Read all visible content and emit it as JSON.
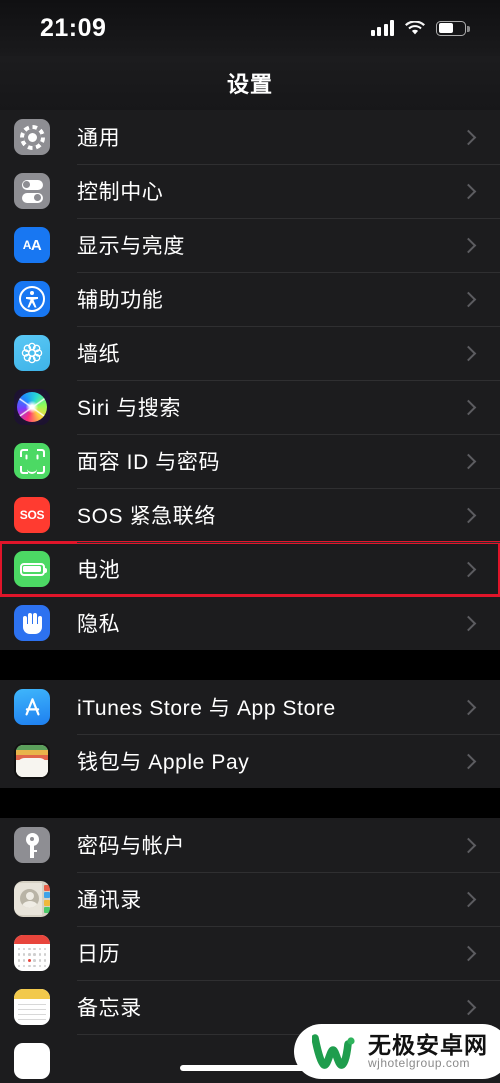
{
  "status_bar": {
    "time": "21:09",
    "signal_icon": "cellular-bars-icon",
    "wifi_icon": "wifi-icon",
    "battery_icon": "battery-icon"
  },
  "nav": {
    "title": "设置"
  },
  "colors": {
    "page_background": "#000000",
    "row_background": "#1c1c1e",
    "separator": "#2f2f31",
    "label_text": "#ffffff",
    "chevron": "#5c5c60",
    "highlight_box": "#e0152a"
  },
  "groups": [
    {
      "rows": [
        {
          "label": "通用",
          "icon": "gear-icon",
          "chevron": true,
          "highlighted": false
        },
        {
          "label": "控制中心",
          "icon": "control-center-icon",
          "chevron": true,
          "highlighted": false
        },
        {
          "label": "显示与亮度",
          "icon": "display-brightness-icon",
          "chevron": true,
          "highlighted": false
        },
        {
          "label": "辅助功能",
          "icon": "accessibility-icon",
          "chevron": true,
          "highlighted": false
        },
        {
          "label": "墙纸",
          "icon": "wallpaper-icon",
          "chevron": true,
          "highlighted": false
        },
        {
          "label": "Siri 与搜索",
          "icon": "siri-icon",
          "chevron": true,
          "highlighted": false
        },
        {
          "label": "面容 ID 与密码",
          "icon": "face-id-icon",
          "chevron": true,
          "highlighted": false
        },
        {
          "label": "SOS 紧急联络",
          "icon": "sos-icon",
          "chevron": true,
          "highlighted": false
        },
        {
          "label": "电池",
          "icon": "battery-settings-icon",
          "chevron": true,
          "highlighted": true
        },
        {
          "label": "隐私",
          "icon": "privacy-hand-icon",
          "chevron": true,
          "highlighted": false
        }
      ]
    },
    {
      "rows": [
        {
          "label": "iTunes Store 与 App Store",
          "icon": "app-store-icon",
          "chevron": true,
          "highlighted": false
        },
        {
          "label": "钱包与 Apple Pay",
          "icon": "wallet-icon",
          "chevron": true,
          "highlighted": false
        }
      ]
    },
    {
      "rows": [
        {
          "label": "密码与帐户",
          "icon": "key-icon",
          "chevron": true,
          "highlighted": false
        },
        {
          "label": "通讯录",
          "icon": "contacts-icon",
          "chevron": true,
          "highlighted": false
        },
        {
          "label": "日历",
          "icon": "calendar-icon",
          "chevron": true,
          "highlighted": false
        },
        {
          "label": "备忘录",
          "icon": "notes-icon",
          "chevron": true,
          "highlighted": false
        },
        {
          "label": "",
          "icon": "partial-row-icon",
          "chevron": false,
          "highlighted": false
        }
      ]
    }
  ],
  "watermark": {
    "title": "无极安卓网",
    "url": "wjhotelgroup.com",
    "logo": "w-logo-icon"
  }
}
